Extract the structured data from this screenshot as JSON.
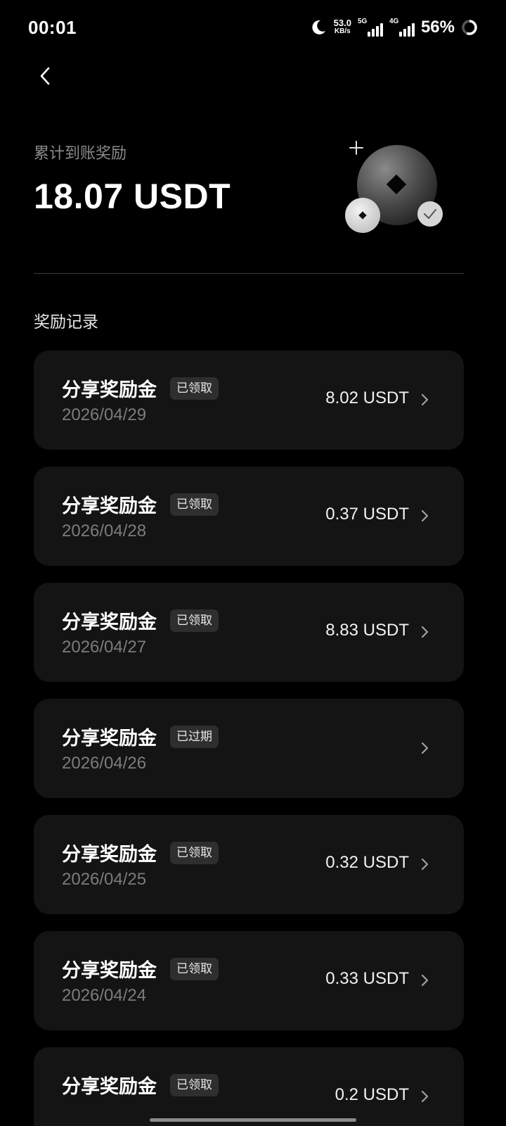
{
  "status_bar": {
    "time": "00:01",
    "net_speed_value": "53.0",
    "net_speed_unit": "KB/s",
    "sim1_type": "5G",
    "sim2_type": "4G",
    "battery_percent": "56%"
  },
  "summary": {
    "label": "累计到账奖励",
    "amount": "18.07 USDT"
  },
  "section_title": "奖励记录",
  "records": [
    {
      "name": "分享奖励金",
      "badge": "已领取",
      "date": "2026/04/29",
      "amount": "8.02 USDT"
    },
    {
      "name": "分享奖励金",
      "badge": "已领取",
      "date": "2026/04/28",
      "amount": "0.37 USDT"
    },
    {
      "name": "分享奖励金",
      "badge": "已领取",
      "date": "2026/04/27",
      "amount": "8.83 USDT"
    },
    {
      "name": "分享奖励金",
      "badge": "已过期",
      "date": "2026/04/26",
      "amount": ""
    },
    {
      "name": "分享奖励金",
      "badge": "已领取",
      "date": "2026/04/25",
      "amount": "0.32 USDT"
    },
    {
      "name": "分享奖励金",
      "badge": "已领取",
      "date": "2026/04/24",
      "amount": "0.33 USDT"
    },
    {
      "name": "分享奖励金",
      "badge": "已领取",
      "date": "",
      "amount": "0.2 USDT"
    }
  ],
  "icons": {
    "back": "chevron-left-icon",
    "row_arrow": "chevron-right-icon",
    "illustration": "coin-illustration"
  },
  "colors": {
    "background": "#000000",
    "card": "#141414",
    "badge": "#2e2e2e",
    "muted_text": "#8a8a8a"
  }
}
